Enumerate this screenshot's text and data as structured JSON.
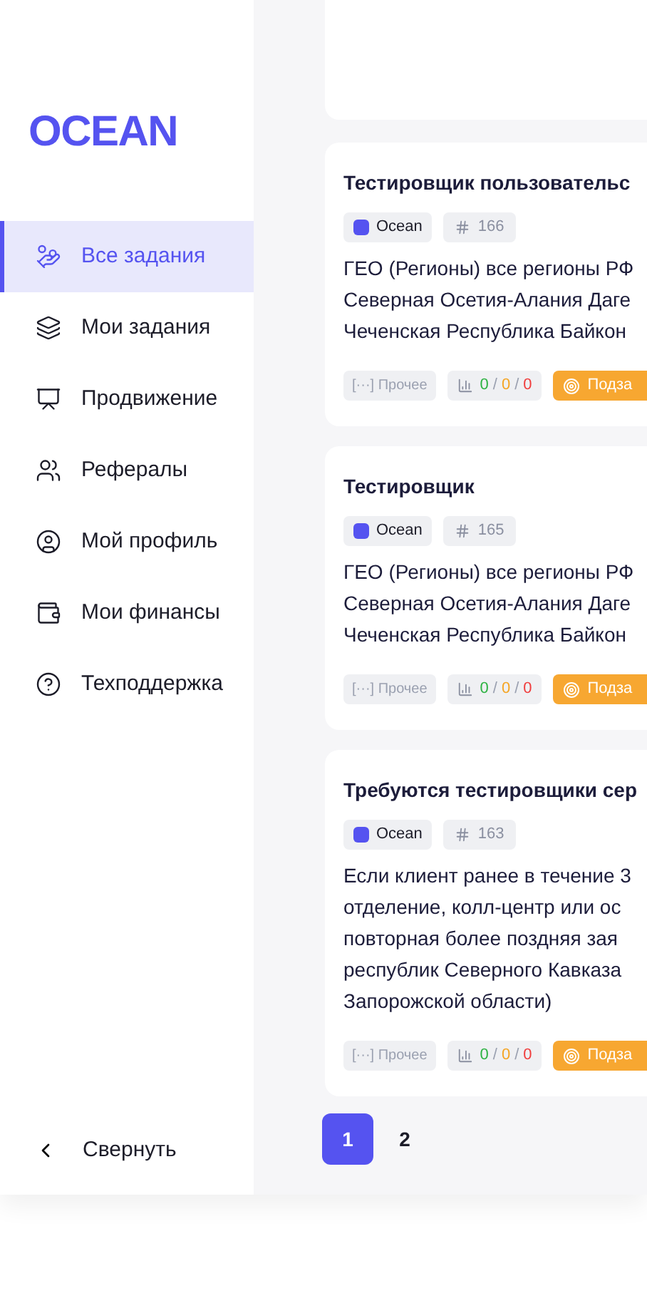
{
  "logo": "OCEAN",
  "sidebar": {
    "items": [
      {
        "label": "Все задания",
        "selected": true
      },
      {
        "label": "Мои задания",
        "selected": false
      },
      {
        "label": "Продвижение",
        "selected": false
      },
      {
        "label": "Рефералы",
        "selected": false
      },
      {
        "label": "Мой профиль",
        "selected": false
      },
      {
        "label": "Мои финансы",
        "selected": false
      },
      {
        "label": "Техподдержка",
        "selected": false
      }
    ],
    "collapse": "Свернуть"
  },
  "tasks": [
    {
      "title": "Тестировщик пользовательс",
      "author": "Ocean",
      "id": "166",
      "description": [
        "ГЕО (Регионы) все регионы РФ",
        "Северная Осетия-Алания Даге",
        "Чеченская Республика Байкон"
      ],
      "category": "[···] Прочее",
      "stats": [
        "0",
        "/",
        "0",
        "/",
        "0"
      ],
      "action": "Подза"
    },
    {
      "title": "Тестировщик",
      "author": "Ocean",
      "id": "165",
      "description": [
        "ГЕО (Регионы) все регионы РФ",
        "Северная Осетия-Алания Даге",
        "Чеченская Республика Байкон"
      ],
      "category": "[···] Прочее",
      "stats": [
        "0",
        "/",
        "0",
        "/",
        "0"
      ],
      "action": "Подза"
    },
    {
      "title": "Требуются тестировщики сер",
      "author": "Ocean",
      "id": "163",
      "description": [
        "Если клиент ранее в течение 3",
        "отделение, колл-центр или ос",
        "повторная более поздняя зая",
        "республик Северного Кавказа",
        "Запорожской области)"
      ],
      "category": "[···] Прочее",
      "stats": [
        "0",
        "/",
        "0",
        "/",
        "0"
      ],
      "action": "Подза"
    }
  ],
  "pagination": [
    {
      "label": "1",
      "selected": true
    },
    {
      "label": "2",
      "selected": false
    }
  ]
}
